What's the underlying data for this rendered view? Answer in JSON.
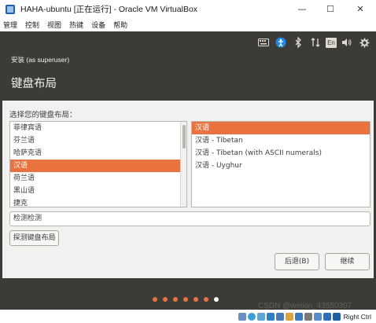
{
  "window": {
    "title": "HAHA-ubuntu [正在运行] - Oracle VM VirtualBox",
    "minimize": "—",
    "maximize": "☐",
    "close": "✕"
  },
  "menubar": {
    "items": [
      {
        "label": "管理"
      },
      {
        "label": "控制"
      },
      {
        "label": "视图"
      },
      {
        "label": "热键"
      },
      {
        "label": "设备"
      },
      {
        "label": "帮助"
      }
    ]
  },
  "tray": {
    "keyboard_indicator": "En",
    "icons": [
      "keyboard-icon",
      "accessibility-icon",
      "bluetooth-icon",
      "network-icon",
      "keyboard-layout-icon",
      "volume-icon",
      "settings-gear-icon"
    ]
  },
  "installer": {
    "header_title": "安装 (as superuser)",
    "page_title": "键盘布局",
    "prompt": "选择您的键盘布局：",
    "layouts": [
      {
        "label": "菲律宾语",
        "selected": false
      },
      {
        "label": "芬兰语",
        "selected": false
      },
      {
        "label": "哈萨克语",
        "selected": false
      },
      {
        "label": "汉语",
        "selected": true
      },
      {
        "label": "荷兰语",
        "selected": false
      },
      {
        "label": "黑山语",
        "selected": false
      },
      {
        "label": "捷克",
        "selected": false
      }
    ],
    "variants": [
      {
        "label": "汉语",
        "selected": true
      },
      {
        "label": "汉语 - Tibetan",
        "selected": false
      },
      {
        "label": "汉语 - Tibetan (with ASCII numerals)",
        "selected": false
      },
      {
        "label": "汉语 - Uyghur",
        "selected": false
      }
    ],
    "test_input_value": "检测检测",
    "detect_button": "探测键盘布局",
    "back_button": "后退(B)",
    "continue_button": "继续",
    "progress": {
      "total_steps": 7,
      "current_step": 7
    }
  },
  "statusbar": {
    "host_key": "Right Ctrl"
  },
  "watermark": "CSDN @weixin_43550307",
  "colors": {
    "accent": "#e9733f",
    "panel": "#3c3b37",
    "body": "#f2f1f0"
  }
}
